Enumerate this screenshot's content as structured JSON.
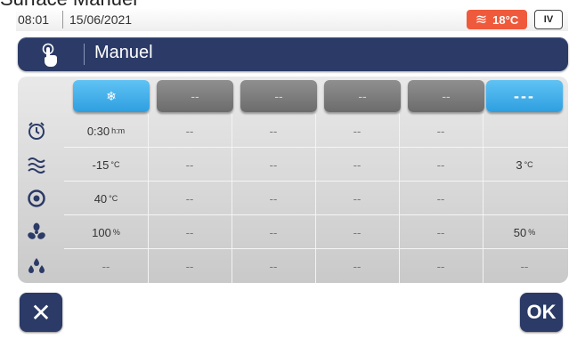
{
  "page_title": "Surface Manuel",
  "status": {
    "time": "08:01",
    "date": "15/06/2021",
    "temperature": "18°C",
    "temperature_icon": "wave-icon",
    "mode_badge": "IV"
  },
  "mode": {
    "icon": "touch-hand-icon",
    "label": "Manuel"
  },
  "steps": [
    {
      "label": "❄",
      "icon": "snowflake-icon",
      "active": true
    },
    {
      "label": "--",
      "active": false
    },
    {
      "label": "--",
      "active": false
    },
    {
      "label": "--",
      "active": false
    },
    {
      "label": "--",
      "active": false
    },
    {
      "label": "---",
      "active": true
    }
  ],
  "rows": [
    {
      "icon": "alarm-clock-icon",
      "cells": [
        {
          "value": "0:30",
          "unit": "h:m"
        },
        {
          "value": "--"
        },
        {
          "value": "--"
        },
        {
          "value": "--"
        },
        {
          "value": "--"
        },
        {
          "value": ""
        }
      ]
    },
    {
      "icon": "air-temperature-icon",
      "cells": [
        {
          "value": "-15",
          "unit": "°C"
        },
        {
          "value": "--"
        },
        {
          "value": "--"
        },
        {
          "value": "--"
        },
        {
          "value": "--"
        },
        {
          "value": "3",
          "unit": "°C"
        }
      ]
    },
    {
      "icon": "probe-target-icon",
      "cells": [
        {
          "value": "40",
          "unit": "°C"
        },
        {
          "value": "--"
        },
        {
          "value": "--"
        },
        {
          "value": "--"
        },
        {
          "value": "--"
        },
        {
          "value": ""
        }
      ]
    },
    {
      "icon": "fan-icon",
      "cells": [
        {
          "value": "100",
          "unit": "%"
        },
        {
          "value": "--"
        },
        {
          "value": "--"
        },
        {
          "value": "--"
        },
        {
          "value": "--"
        },
        {
          "value": "50",
          "unit": "%"
        }
      ]
    },
    {
      "icon": "humidity-drops-icon",
      "cells": [
        {
          "value": "--"
        },
        {
          "value": "--"
        },
        {
          "value": "--"
        },
        {
          "value": "--"
        },
        {
          "value": "--"
        },
        {
          "value": "--"
        }
      ]
    }
  ],
  "buttons": {
    "cancel_label": "✕",
    "ok_label": "OK"
  },
  "colors": {
    "navy": "#2b3a66",
    "active_blue": "#3aa8e8",
    "temp_badge": "#f05a3c",
    "inactive_gray": "#7d7d7d"
  }
}
